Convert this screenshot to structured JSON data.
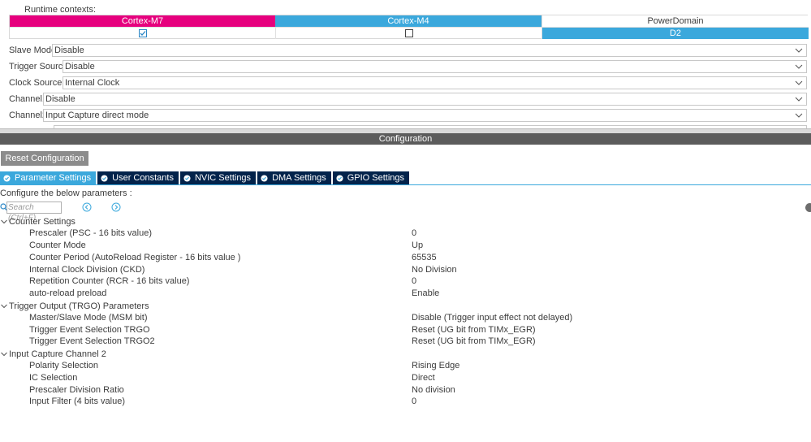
{
  "runtime": {
    "label": "Runtime contexts:",
    "contexts": [
      {
        "name": "Cortex-M7",
        "checked": true,
        "color": "#e6007e"
      },
      {
        "name": "Cortex-M4",
        "checked": false,
        "color": "#3ba8dc"
      }
    ],
    "power_domain_label": "PowerDomain",
    "power_domain_value": "D2"
  },
  "modes": [
    {
      "label": "Slave Mode",
      "value": "Disable"
    },
    {
      "label": "Trigger Source",
      "value": "Disable"
    },
    {
      "label": "Clock Source",
      "value": "Internal Clock"
    },
    {
      "label": "Channel1",
      "value": "Disable"
    },
    {
      "label": "Channel2",
      "value": "Input Capture direct mode"
    }
  ],
  "configuration": {
    "title": "Configuration",
    "reset_label": "Reset Configuration",
    "tabs": [
      {
        "label": "Parameter Settings",
        "active": true
      },
      {
        "label": "User Constants",
        "active": false
      },
      {
        "label": "NVIC Settings",
        "active": false
      },
      {
        "label": "DMA Settings",
        "active": false
      },
      {
        "label": "GPIO Settings",
        "active": false
      }
    ],
    "instruction": "Configure the below parameters :",
    "search_placeholder": "Search (Ctrl+F)"
  },
  "groups": [
    {
      "title": "Counter Settings",
      "params": [
        {
          "name": "Prescaler (PSC - 16 bits value)",
          "value": "0"
        },
        {
          "name": "Counter Mode",
          "value": "Up"
        },
        {
          "name": "Counter Period (AutoReload Register - 16 bits value )",
          "value": "65535"
        },
        {
          "name": "Internal Clock Division (CKD)",
          "value": "No Division"
        },
        {
          "name": "Repetition Counter (RCR - 16 bits value)",
          "value": "0"
        },
        {
          "name": "auto-reload preload",
          "value": "Enable"
        }
      ]
    },
    {
      "title": "Trigger Output (TRGO) Parameters",
      "params": [
        {
          "name": "Master/Slave Mode (MSM bit)",
          "value": "Disable (Trigger input effect not delayed)"
        },
        {
          "name": "Trigger Event Selection TRGO",
          "value": "Reset (UG bit from TIMx_EGR)"
        },
        {
          "name": "Trigger Event Selection TRGO2",
          "value": "Reset (UG bit from TIMx_EGR)"
        }
      ]
    },
    {
      "title": "Input Capture Channel 2",
      "params": [
        {
          "name": "Polarity Selection",
          "value": "Rising Edge"
        },
        {
          "name": "IC Selection",
          "value": "Direct"
        },
        {
          "name": "Prescaler Division Ratio",
          "value": "No division"
        },
        {
          "name": "Input Filter (4 bits value)",
          "value": "0"
        }
      ]
    }
  ]
}
